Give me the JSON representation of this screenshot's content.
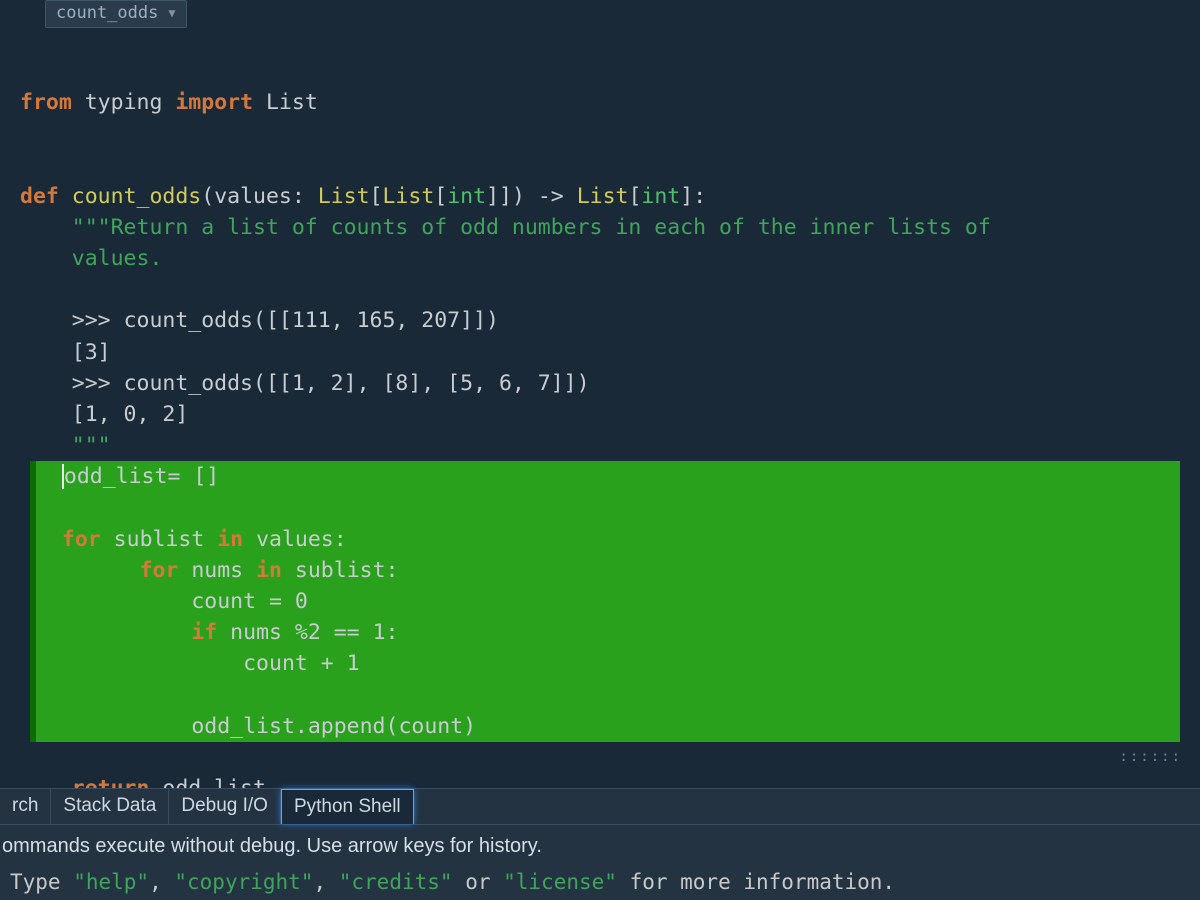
{
  "dropdown": {
    "label": "count_odds"
  },
  "code": {
    "import_line": {
      "from": "from",
      "module": "typing",
      "import": "import",
      "name": "List"
    },
    "def": {
      "kw": "def",
      "name": "count_odds",
      "params_open": "(values: ",
      "list_outer": "List",
      "bracket1": "[",
      "list_inner": "List",
      "bracket2": "[",
      "int1": "int",
      "bracket3": "]]) ",
      "arrow": "->",
      "space": " ",
      "ret_list": "List",
      "bracket4": "[",
      "int2": "int",
      "bracket5": "]:"
    },
    "doc1": "\"\"\"Return a list of counts of odd numbers in each of the inner lists of",
    "doc2": "values.",
    "ex1_prompt": ">>> ",
    "ex1_call": "count_odds",
    "ex1_args": "([[111, 165, 207]])",
    "ex1_out": "[3]",
    "ex2_prompt": ">>> ",
    "ex2_call": "count_odds",
    "ex2_args": "([[1, 2], [8], [5, 6, 7]])",
    "ex2_out": "[1, 0, 2]",
    "doc_close": "\"\"\"",
    "body": {
      "l1": "odd_list= []",
      "l2a": "for",
      "l2b": " sublist ",
      "l2c": "in",
      "l2d": " values:",
      "l3a": "for",
      "l3b": " nums ",
      "l3c": "in",
      "l3d": " sublist:",
      "l4": "count = 0",
      "l5a": "if",
      "l5b": " nums %2 == 1:",
      "l6": "count + 1",
      "l7": "odd_list.append(count)",
      "ret_kw": "return",
      "ret_rest": " odd_list"
    }
  },
  "tabs": {
    "t0": "rch",
    "t1": "Stack Data",
    "t2": "Debug I/O",
    "t3": "Python Shell"
  },
  "hint": "ommands execute without debug.  Use arrow keys for history.",
  "shell": {
    "pre": "Type ",
    "s1": "\"help\"",
    "mid1": ", ",
    "s2": "\"copyright\"",
    "mid2": ", ",
    "s3": "\"credits\"",
    "mid3": " or ",
    "s4": "\"license\"",
    "post": " for more information."
  },
  "dragger": "::::::"
}
